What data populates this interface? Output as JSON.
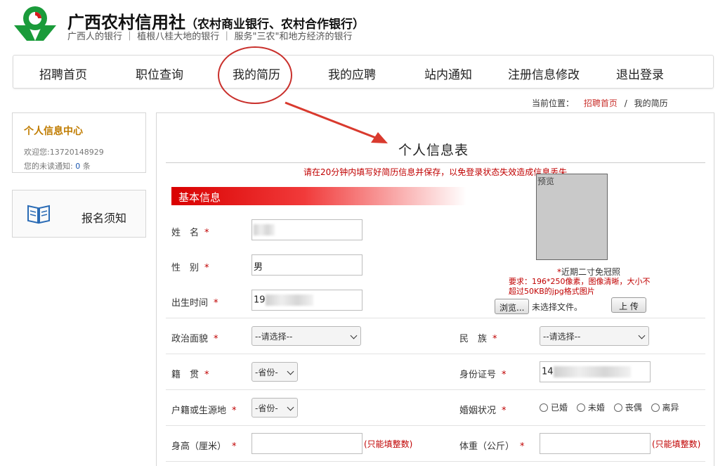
{
  "header": {
    "title": "广西农村信用社",
    "subtitle": "（农村商业银行、农村合作银行）",
    "slogan": "广西人的银行 ｜ 植根八桂大地的银行 ｜ 服务\"三农\"和地方经济的银行",
    "brand_color": "#1a9b3a"
  },
  "nav": {
    "items": [
      {
        "label": "招聘首页"
      },
      {
        "label": "职位查询"
      },
      {
        "label": "我的简历"
      },
      {
        "label": "我的应聘"
      },
      {
        "label": "站内通知"
      },
      {
        "label": "注册信息修改"
      },
      {
        "label": "退出登录"
      }
    ],
    "highlighted": "我的简历"
  },
  "breadcrumb": {
    "prefix": "当前位置：",
    "home": "招聘首页",
    "separator": "/",
    "current": "我的简历"
  },
  "sidebar": {
    "center_title": "个人信息中心",
    "welcome": "欢迎您:13720148929",
    "unread_label": "您的未读通知:",
    "unread_count": "0",
    "unread_unit": "条",
    "notice_label": "报名须知",
    "notice_icon": "book-icon"
  },
  "form": {
    "title": "个人信息表",
    "warning": "请在20分钟内填写好简历信息并保存，以免登录状态失效造成信息丢失",
    "section": "基本信息",
    "required_mark": "*",
    "name_label": "姓　名",
    "gender_label": "性　别",
    "gender_value": "男",
    "birth_label": "出生时间",
    "birth_value": "19",
    "political_label": "政治面貌",
    "political_value": "--请选择--",
    "ethnic_label": "民　族",
    "ethnic_value": "--请选择--",
    "native_label": "籍　贯",
    "native_value": "-省份-",
    "idcard_label": "身份证号",
    "idcard_value": "14",
    "hukou_label": "户籍或生源地",
    "hukou_value": "-省份-",
    "marital_label": "婚姻状况",
    "marital_options": [
      "已婚",
      "未婚",
      "丧偶",
      "离异"
    ],
    "height_label": "身高（厘米）",
    "height_hint": "(只能填整数)",
    "weight_label": "体重（公斤）",
    "weight_hint": "(只能填整数)",
    "photo": {
      "preview_label": "预览",
      "note": "近期二寸免冠照",
      "requirement": "要求：196*250像素，图像清晰，大小不超过50KB的jpg格式图片",
      "browse_label": "浏览...",
      "no_file": "未选择文件。",
      "upload_label": "上 传"
    }
  }
}
